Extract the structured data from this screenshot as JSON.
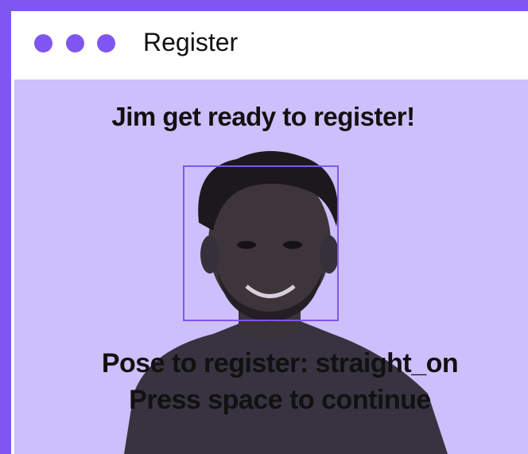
{
  "window": {
    "title": "Register",
    "controls": [
      "close-dot",
      "minimize-dot",
      "maximize-dot"
    ]
  },
  "camera": {
    "heading": "Jim get ready to register!",
    "pose_prompt": "Pose to register: straight_on",
    "continue_prompt": "Press space to continue"
  },
  "colors": {
    "accent": "#7f56f2",
    "background": "#cdbffb",
    "text": "#111111"
  }
}
